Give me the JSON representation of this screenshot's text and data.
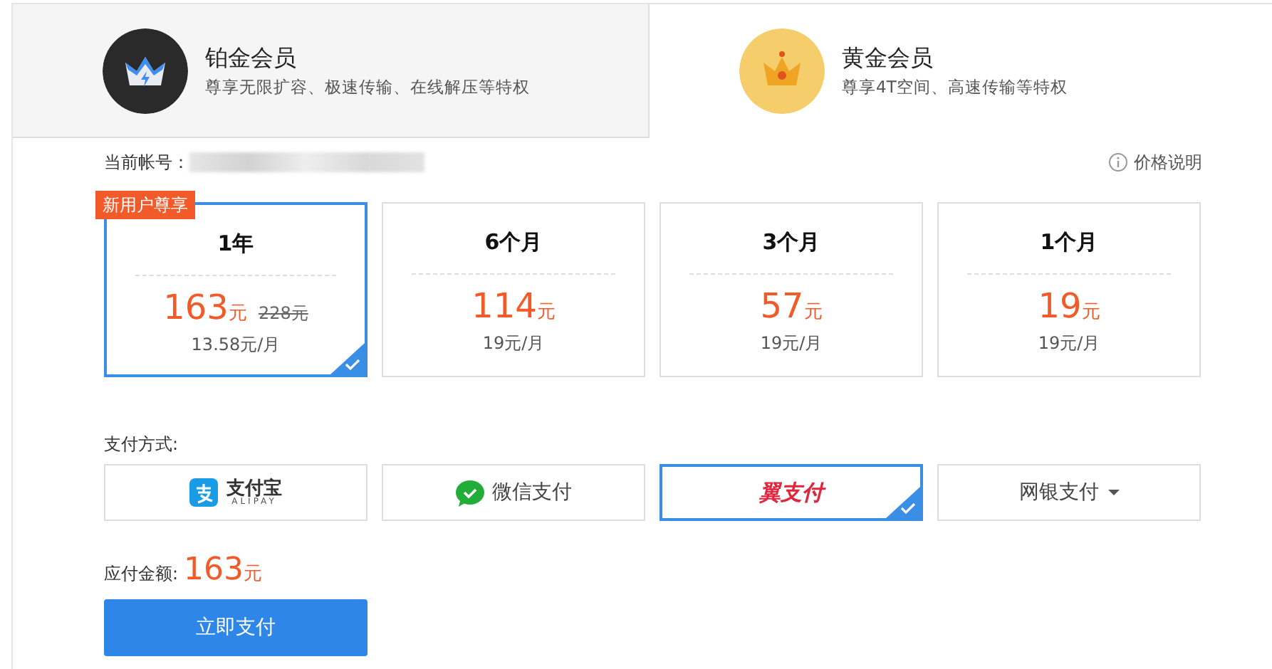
{
  "tabs": [
    {
      "kind": "platinum",
      "title": "铂金会员",
      "subtitle": "尊享无限扩容、极速传输、在线解压等特权",
      "selected": false
    },
    {
      "kind": "gold",
      "title": "黄金会员",
      "subtitle": "尊享4T空间、高速传输等特权",
      "selected": true
    }
  ],
  "account_label": "当前帐号：",
  "price_info": "价格说明",
  "plans": [
    {
      "badge": "新用户尊享",
      "duration": "1年",
      "price": "163",
      "unit": "元",
      "original_price": "228元",
      "monthly": "13.58元/月",
      "selected": true
    },
    {
      "duration": "6个月",
      "price": "114",
      "unit": "元",
      "monthly": "19元/月",
      "selected": false
    },
    {
      "duration": "3个月",
      "price": "57",
      "unit": "元",
      "monthly": "19元/月",
      "selected": false
    },
    {
      "duration": "1个月",
      "price": "19",
      "unit": "元",
      "monthly": "19元/月",
      "selected": false
    }
  ],
  "payment_label": "支付方式:",
  "payment_methods": [
    {
      "kind": "alipay",
      "label": "支付宝",
      "sublabel": "ALIPAY",
      "selected": false
    },
    {
      "kind": "wechat",
      "label": "微信支付",
      "selected": false
    },
    {
      "kind": "bestpay",
      "label": "翼支付",
      "selected": true
    },
    {
      "kind": "bank",
      "label": "网银支付",
      "selected": false
    }
  ],
  "amount_label": "应付金额:",
  "amount": "163",
  "amount_unit": "元",
  "pay_button": "立即支付"
}
